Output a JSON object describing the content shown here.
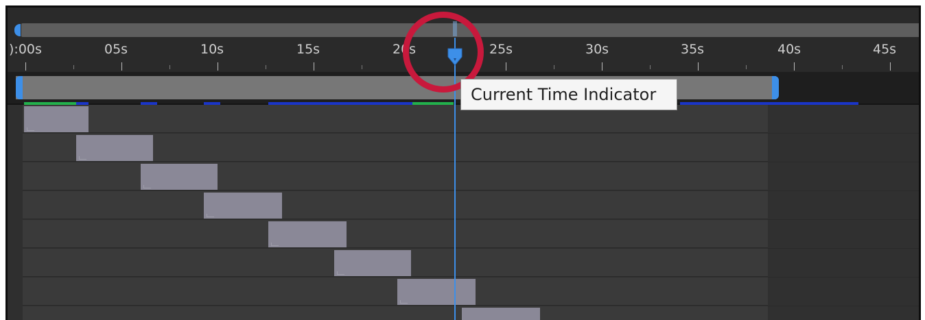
{
  "ruler": {
    "labels": [
      "):00s",
      "05s",
      "10s",
      "15s",
      "20s",
      "25s",
      "30s",
      "35s",
      "40s",
      "45s"
    ]
  },
  "current_time": {
    "indicator_icon": "playhead-icon",
    "tooltip_text": "Current Time Indicator"
  },
  "colors": {
    "accent_blue": "#3d8fe8",
    "highlight_red": "#c8193c",
    "cache_green": "#22b14c",
    "cache_blue": "#1a35c8",
    "clip_fill": "#8a8897"
  },
  "layers": {
    "count": 8
  }
}
